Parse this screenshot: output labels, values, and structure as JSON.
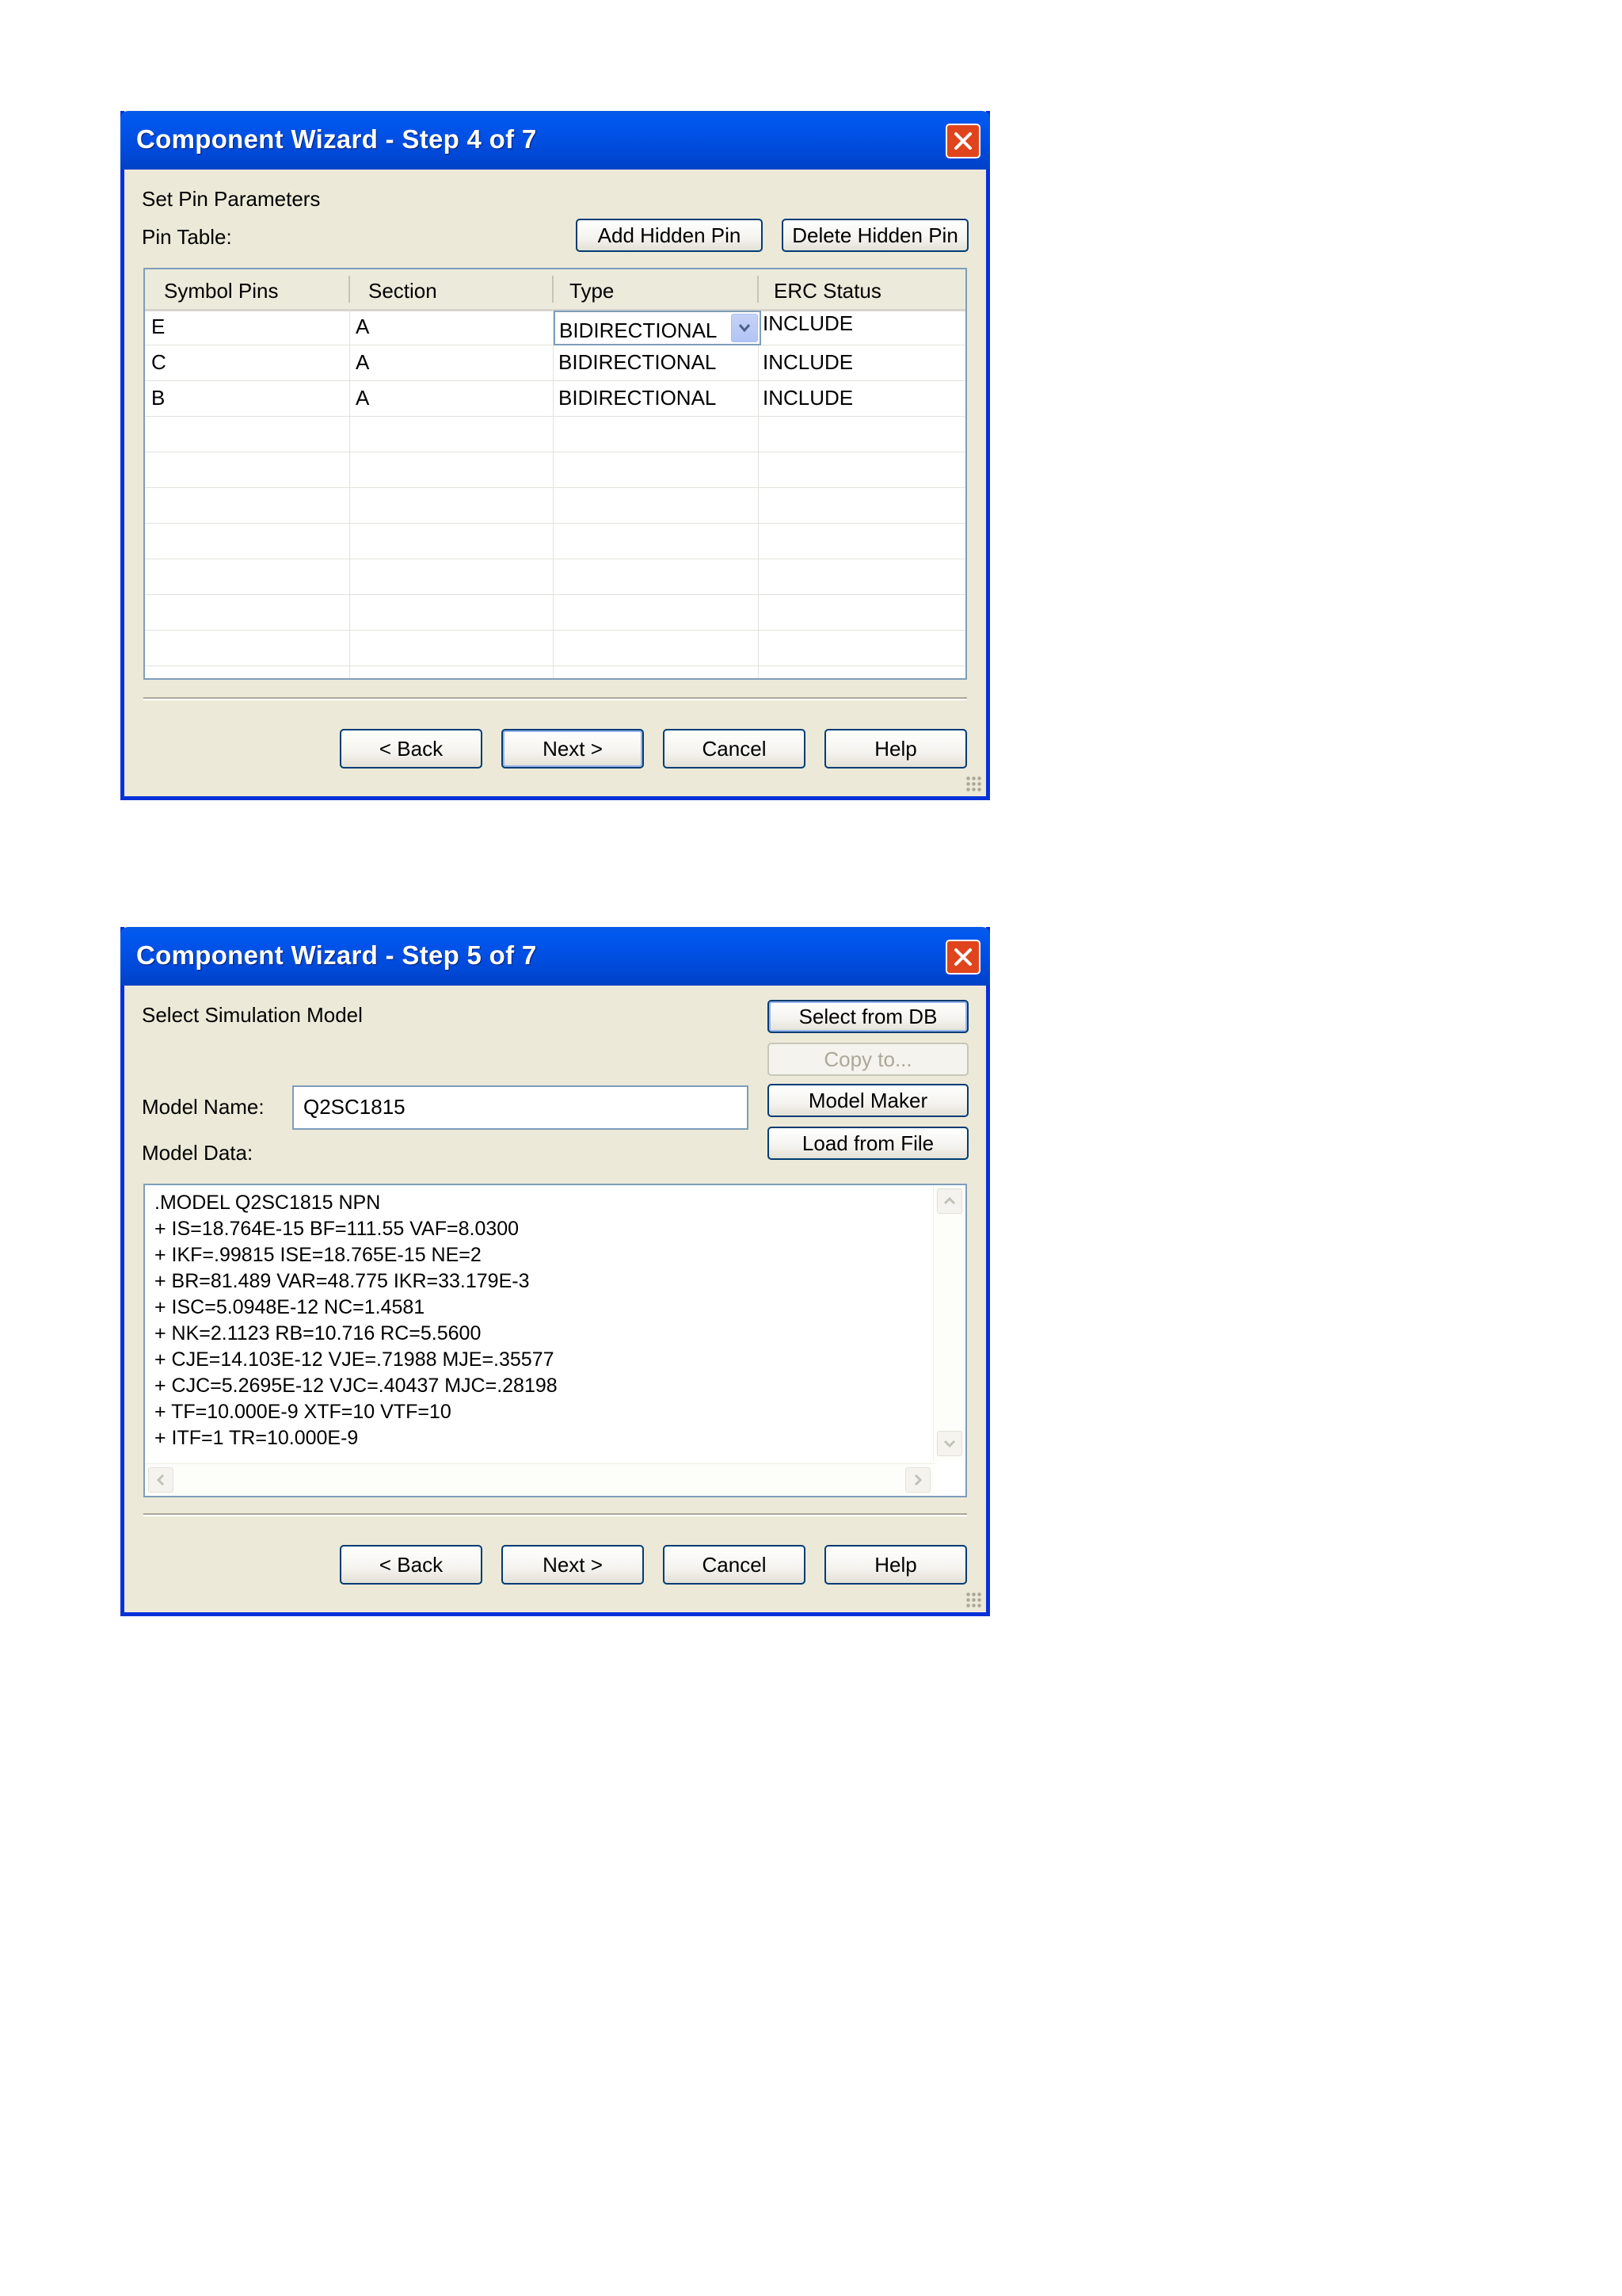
{
  "step4": {
    "title": "Component Wizard - Step 4 of 7",
    "heading": "Set Pin Parameters",
    "pin_table_label": "Pin Table:",
    "add_hidden_pin": "Add Hidden Pin",
    "delete_hidden_pin": "Delete Hidden Pin",
    "columns": [
      "Symbol Pins",
      "Section",
      "Type",
      "ERC Status"
    ],
    "rows": [
      {
        "pin": "E",
        "section": "A",
        "type": "BIDIRECTIONAL",
        "erc": "INCLUDE"
      },
      {
        "pin": "C",
        "section": "A",
        "type": "BIDIRECTIONAL",
        "erc": "INCLUDE"
      },
      {
        "pin": "B",
        "section": "A",
        "type": "BIDIRECTIONAL",
        "erc": "INCLUDE"
      }
    ],
    "buttons": {
      "back": "< Back",
      "next": "Next >",
      "cancel": "Cancel",
      "help": "Help"
    }
  },
  "step5": {
    "title": "Component Wizard - Step 5 of 7",
    "heading": "Select Simulation Model",
    "select_from_db": "Select from DB",
    "copy_to": "Copy to...",
    "model_maker": "Model Maker",
    "load_from_file": "Load from File",
    "model_name_label": "Model Name:",
    "model_name_value": "Q2SC1815",
    "model_data_label": "Model Data:",
    "model_data_lines": [
      ".MODEL Q2SC1815  NPN",
      "+ IS=18.764E-15 BF=111.55 VAF=8.0300",
      "+ IKF=.99815 ISE=18.765E-15 NE=2",
      "+ BR=81.489 VAR=48.775 IKR=33.179E-3",
      "+ ISC=5.0948E-12 NC=1.4581",
      "+ NK=2.1123 RB=10.716 RC=5.5600",
      "+ CJE=14.103E-12 VJE=.71988 MJE=.35577",
      "+ CJC=5.2695E-12 VJC=.40437 MJC=.28198",
      "+ TF=10.000E-9 XTF=10 VTF=10",
      "+ ITF=1 TR=10.000E-9"
    ],
    "buttons": {
      "back": "< Back",
      "next": "Next >",
      "cancel": "Cancel",
      "help": "Help"
    }
  },
  "icons": {
    "close": "close-x-icon",
    "dropdown": "chevron-down-icon",
    "scroll_up": "arrow-up-icon",
    "scroll_down": "arrow-down-icon",
    "scroll_left": "arrow-left-icon",
    "scroll_right": "arrow-right-icon"
  },
  "colors": {
    "titlebar": "#0054e3",
    "window_bg": "#ece9d8",
    "close_button": "#e0441d"
  }
}
